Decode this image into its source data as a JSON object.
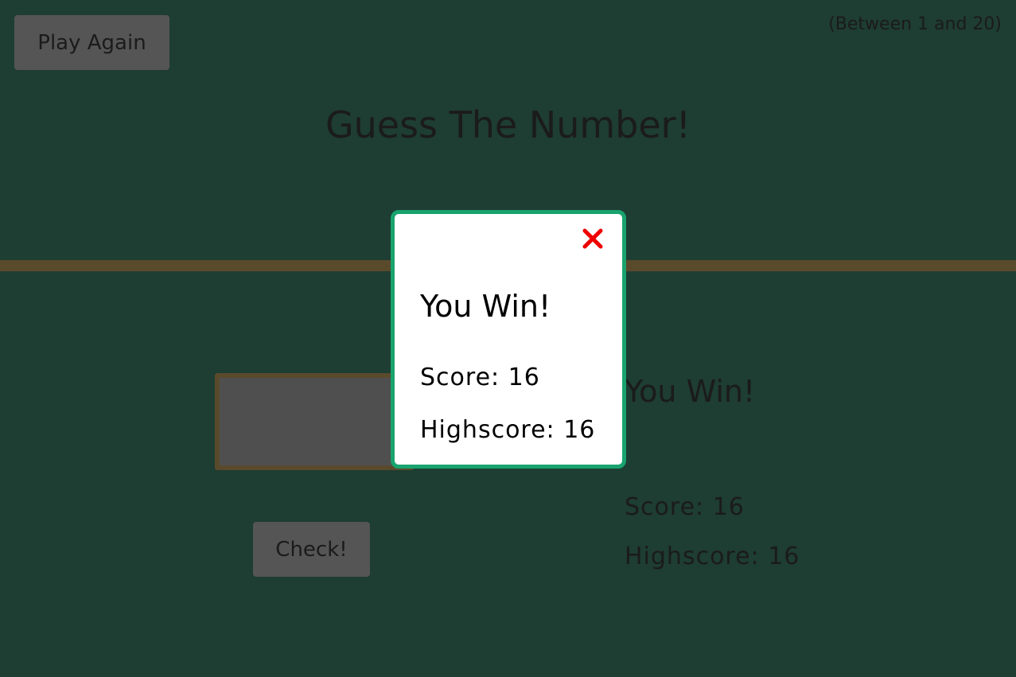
{
  "header": {
    "play_again_label": "Play Again",
    "range_text": "(Between 1 and 20)",
    "title": "Guess The Number!"
  },
  "game": {
    "guess_value": "",
    "check_label": "Check!",
    "message": "You Win!",
    "score_text": "Score: 16",
    "highscore_text": "Highscore: 16"
  },
  "modal": {
    "close_icon": "close-x-icon",
    "title": "You Win!",
    "score_text": "Score: 16",
    "highscore_text": "Highscore: 16"
  },
  "colors": {
    "background": "#1e3d33",
    "modal_border": "#19a36e",
    "close_icon": "#ee0000",
    "divider": "#5a4a2c"
  }
}
